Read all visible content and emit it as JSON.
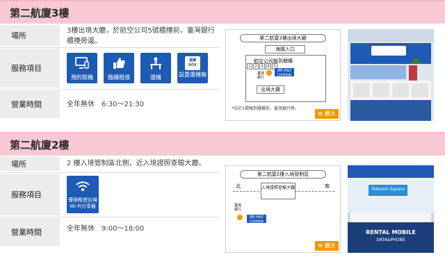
{
  "sections": [
    {
      "title": "第二航廈3樓",
      "labels": {
        "location": "場所",
        "services": "服務項目",
        "hours": "營業時間"
      },
      "location_text": "3樓出境大廳，於航空公司5號櫃檯前，臺灣銀行櫃檯旁邊。",
      "services": [
        {
          "label": "預約取機",
          "icon": "monitor-icon"
        },
        {
          "label": "臨櫃租借",
          "icon": "thumbs-up-icon"
        },
        {
          "label": "還機",
          "icon": "counter-icon"
        },
        {
          "label": "設置還機箱",
          "icon": "return-box-icon"
        }
      ],
      "return_box_icon_text": [
        "還機",
        "BOX"
      ],
      "hours_text": "全年無休　6:30～21:30",
      "map": {
        "title": "第二航廈3樓出境大廳",
        "entrance": "海關入口",
        "counter_label": "航空公司報到櫃檯",
        "counter_numbers": [
          "1",
          "2",
          "3",
          "4",
          "5"
        ],
        "bank_label": "臺灣銀行",
        "logo_text": "Wi-Ho!",
        "logo_sub": "日本特別來",
        "exit_label": "出境大廳",
        "note": "*位於5號報到櫃檯前、臺灣銀行旁。",
        "zoom_label": "擴大"
      }
    },
    {
      "title": "第二航廈2樓",
      "labels": {
        "location": "場所",
        "services": "服務項目",
        "hours": "營業時間"
      },
      "location_text": "2 樓入境管制區北側，近入境證照查驗大廳。",
      "services": [
        {
          "label": "僅限租借台灣 Wi-Fi分享器",
          "icon": "wifi-icon"
        }
      ],
      "hours_text": "全年無休　9:00～18:00",
      "map": {
        "title": "第二航廈2樓入境管制區",
        "north": "北",
        "south": "南",
        "inspection_label": "入境證照查驗大廳",
        "bank_label": "臺灣銀行",
        "logo_text": "Wi-Ho!",
        "logo_sub": "日本特別來",
        "zoom_label": "擴大"
      },
      "photo_signs": [
        "RENTAL MOBILE",
        "DATA&PHONE",
        "Telecom Square"
      ]
    }
  ]
}
